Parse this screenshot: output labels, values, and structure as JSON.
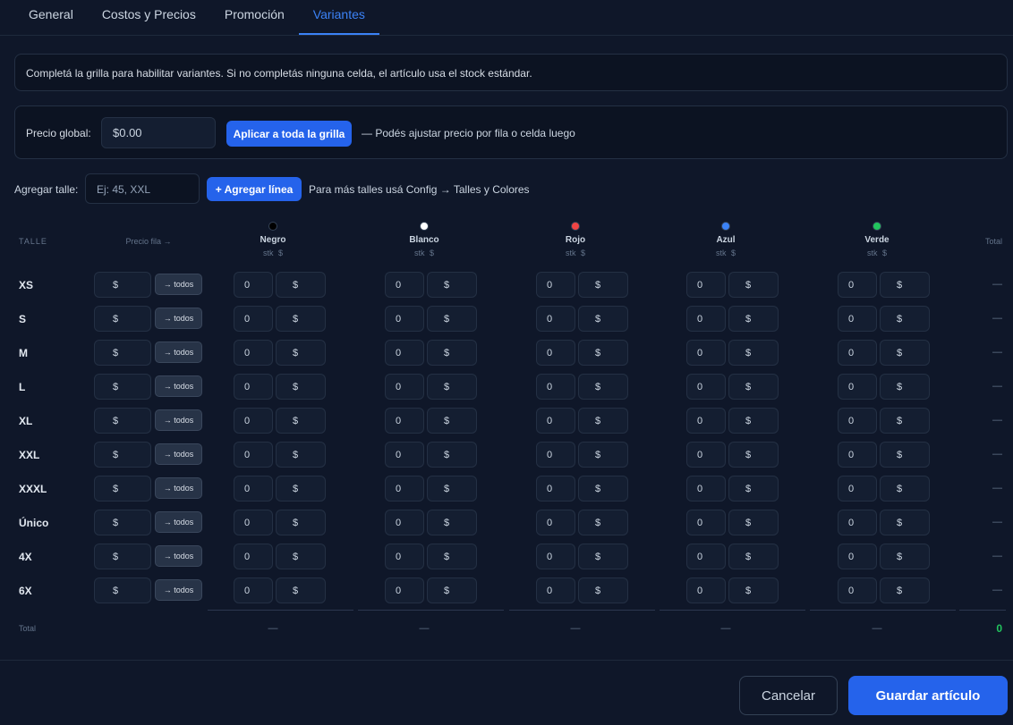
{
  "tabs": [
    {
      "label": "General",
      "active": false
    },
    {
      "label": "Costos y Precios",
      "active": false
    },
    {
      "label": "Promoción",
      "active": false
    },
    {
      "label": "Variantes",
      "active": true
    }
  ],
  "info": "Completá la grilla para habilitar variantes. Si no completás ninguna celda, el artículo usa el stock estándar.",
  "global": {
    "label": "Precio global:",
    "value": "$0.00",
    "apply_label": "Aplicar a toda la grilla",
    "hint": "— Podés ajustar precio por fila o celda luego"
  },
  "add_size": {
    "label": "Agregar talle:",
    "placeholder": "Ej: 45, XXL",
    "button_label": "+ Agregar línea",
    "hint": "Para más talles usá Config → Talles y Colores"
  },
  "grid": {
    "header_talle": "TALLE",
    "header_precio_fila": "Precio fila →",
    "header_total": "Total",
    "colors": [
      {
        "name": "Negro",
        "hex": "#000000"
      },
      {
        "name": "Blanco",
        "hex": "#ffffff"
      },
      {
        "name": "Rojo",
        "hex": "#ef4444"
      },
      {
        "name": "Azul",
        "hex": "#3b82f6"
      },
      {
        "name": "Verde",
        "hex": "#22c55e"
      }
    ],
    "stk_label": "stk",
    "price_label": "$",
    "todos_label": "→ todos",
    "stock_value": "0",
    "sizes": [
      "XS",
      "S",
      "M",
      "L",
      "XL",
      "XXL",
      "XXXL",
      "Único",
      "4X",
      "6X"
    ],
    "row_total": "—",
    "total_label": "Total",
    "col_total": "—",
    "grand_total": "0"
  },
  "footer": {
    "cancel_label": "Cancelar",
    "save_label": "Guardar artículo"
  }
}
